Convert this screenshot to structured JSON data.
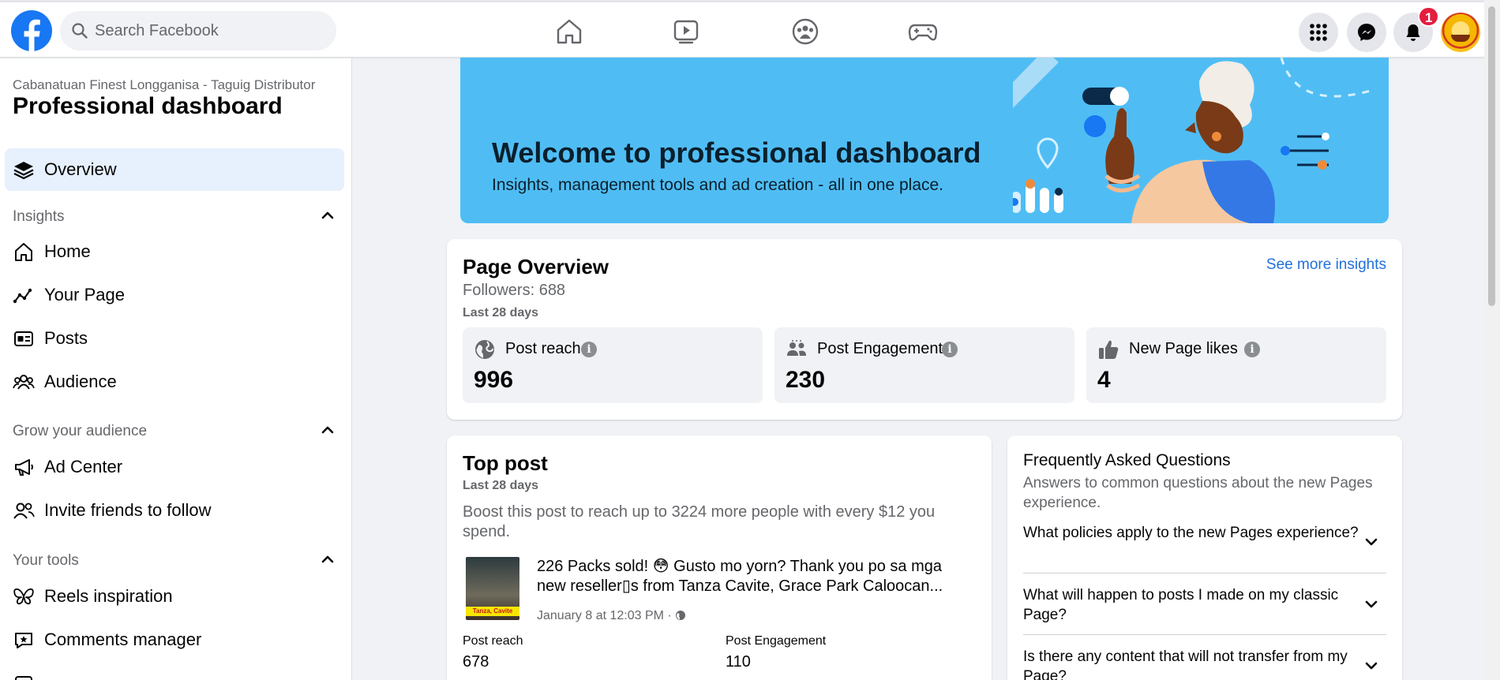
{
  "topbar": {
    "search_placeholder": "Search Facebook",
    "nav_icons": [
      "home-icon",
      "watch-icon",
      "groups-icon",
      "gaming-icon"
    ],
    "right_icons": [
      "menu-grid-icon",
      "messenger-icon",
      "notifications-icon"
    ],
    "notification_count": "1",
    "brand_color": "#1877f2"
  },
  "sidebar": {
    "page_name": "Cabanatuan Finest Longganisa - Taguig Distributor",
    "title": "Professional dashboard",
    "overview": "Overview",
    "sections": [
      {
        "heading": "Insights",
        "items": [
          "Home",
          "Your Page",
          "Posts",
          "Audience"
        ]
      },
      {
        "heading": "Grow your audience",
        "items": [
          "Ad Center",
          "Invite friends to follow"
        ]
      },
      {
        "heading": "Your tools",
        "items": [
          "Reels inspiration",
          "Comments manager"
        ]
      }
    ]
  },
  "welcome": {
    "title": "Welcome to professional dashboard",
    "subtitle": "Insights, management tools and ad creation - all in one place.",
    "banner_color": "#4fbdf4"
  },
  "page_overview": {
    "title": "Page Overview",
    "followers": "Followers: 688",
    "period": "Last 28 days",
    "see_more": "See more insights",
    "metrics": [
      {
        "label": "Post reach",
        "value": "996",
        "icon": "globe-icon"
      },
      {
        "label": "Post Engagement",
        "value": "230",
        "icon": "people-icon"
      },
      {
        "label": "New Page likes",
        "value": "4",
        "icon": "thumbs-up-icon"
      }
    ]
  },
  "top_post": {
    "title": "Top post",
    "period": "Last 28 days",
    "boost_text": "Boost this post to reach up to 3224 more people with every $12 you spend.",
    "post_line1": "226 Packs sold! 😳 Gusto mo yorn? Thank you po sa mga",
    "post_line2": "new reseller▯s from Tanza Cavite, Grace Park Caloocan...",
    "thumb_caption": "Tanza, Cavite",
    "post_date": "January 8 at 12:03 PM ·",
    "stats": [
      {
        "label": "Post reach",
        "value": "678"
      },
      {
        "label": "Post Engagement",
        "value": "110"
      }
    ]
  },
  "faq": {
    "title": "Frequently Asked Questions",
    "subtitle": "Answers to common questions about the new Pages experience.",
    "questions": [
      "What policies apply to the new Pages experience?",
      "What will happen to posts I made on my classic Page?",
      "Is there any content that will not transfer from my Page?"
    ]
  }
}
